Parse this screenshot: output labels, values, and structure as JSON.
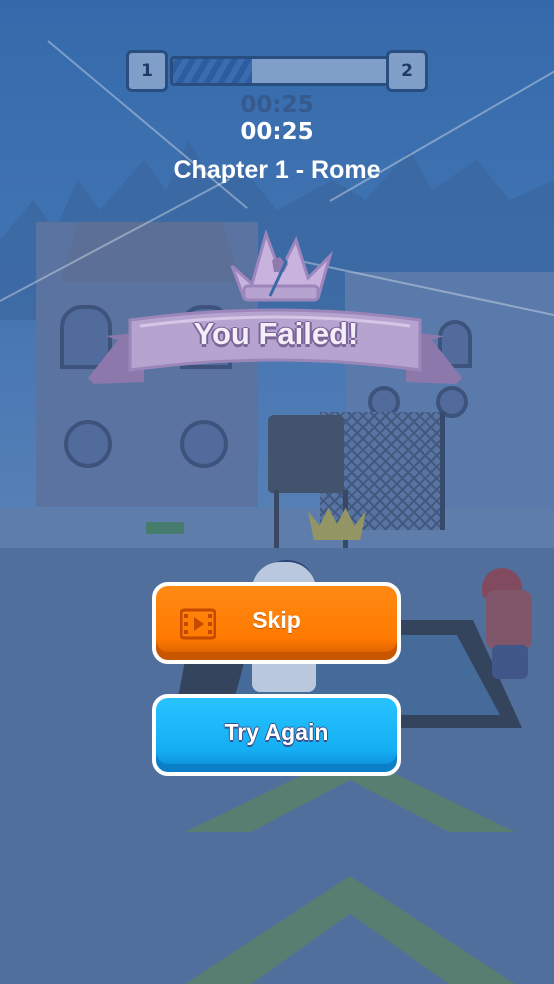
{
  "hud": {
    "level_from": "1",
    "level_to": "2",
    "progress_fraction": 0.37,
    "timer_shadow": "00:25",
    "timer": "00:25",
    "chapter": "Chapter 1 - Rome"
  },
  "result": {
    "title": "You Failed!",
    "icon": "broken-crown-icon"
  },
  "buttons": {
    "skip_label": "Skip",
    "skip_icon": "video-film-icon",
    "retry_label": "Try Again"
  },
  "colors": {
    "skip": "#ff7a00",
    "retry": "#14aff4",
    "banner": "#b6a3cf",
    "hud": "#2a4d80"
  }
}
